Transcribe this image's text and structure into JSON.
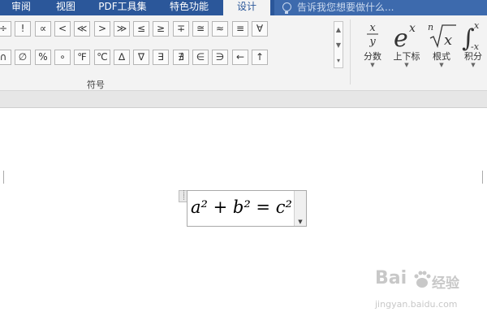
{
  "tabs": [
    {
      "label": "审阅",
      "active": false
    },
    {
      "label": "视图",
      "active": false
    },
    {
      "label": "PDF工具集",
      "active": false
    },
    {
      "label": "特色功能",
      "active": false
    },
    {
      "label": "设计",
      "active": true
    }
  ],
  "tell_me": {
    "placeholder": "告诉我您想要做什么..."
  },
  "symbols": {
    "row1": [
      "÷",
      "!",
      "∝",
      "<",
      "≪",
      ">",
      "≫",
      "≤",
      "≥",
      "∓",
      "≅",
      "≈",
      "≡",
      "∀"
    ],
    "row2": [
      "∩",
      "∅",
      "%",
      "∘",
      "℉",
      "℃",
      "∆",
      "∇",
      "∃",
      "∄",
      "∈",
      "∋",
      "←",
      "↑"
    ],
    "group_label": "符号"
  },
  "structures": [
    {
      "label": "分数",
      "icon": "fraction-icon"
    },
    {
      "label": "上下标",
      "icon": "script-icon"
    },
    {
      "label": "根式",
      "icon": "radical-icon"
    },
    {
      "label": "积分",
      "icon": "integral-icon"
    }
  ],
  "equation": {
    "text": "a² + b² = c²"
  },
  "watermark": {
    "brand": "Bai",
    "name": "经验",
    "url": "jingyan.baidu.com"
  },
  "colors": {
    "accent": "#2b579a",
    "ribbon": "#f3f3f3"
  }
}
